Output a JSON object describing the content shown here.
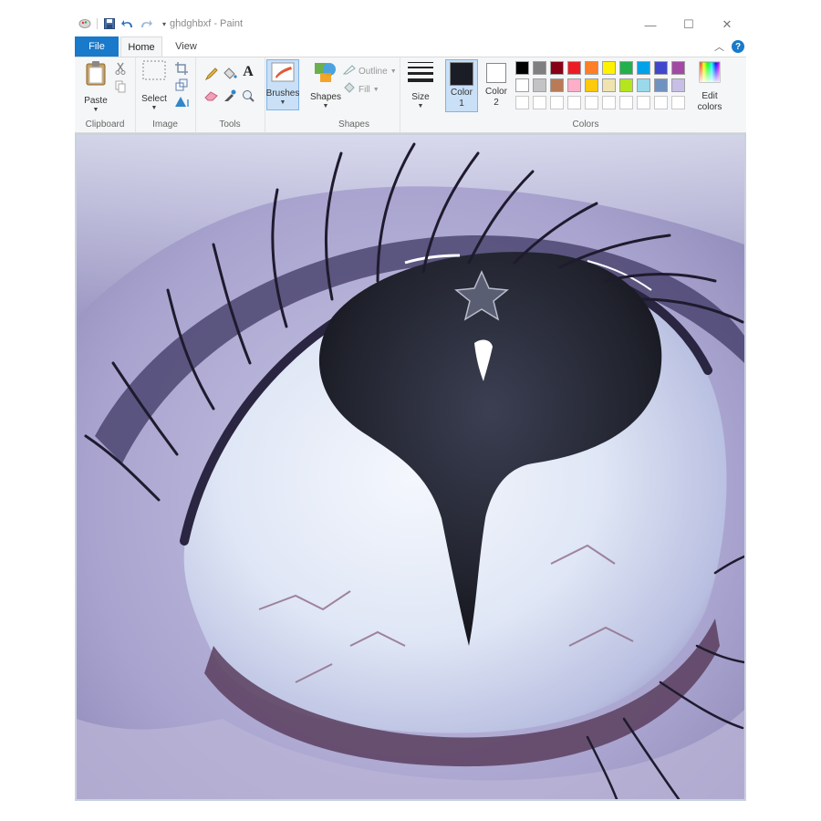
{
  "window": {
    "title": "ghdghbxf - Paint"
  },
  "caption": {
    "minimize": "—",
    "maximize": "☐",
    "close": "✕"
  },
  "tabs": {
    "file": "File",
    "home": "Home",
    "view": "View"
  },
  "help_label": "?",
  "ribbon": {
    "clipboard": {
      "label": "Clipboard",
      "paste_label": "Paste"
    },
    "image": {
      "label": "Image",
      "select_label": "Select"
    },
    "tools": {
      "label": "Tools",
      "text_icon_glyph": "A"
    },
    "brushes": {
      "label": "Brushes"
    },
    "shapes": {
      "label": "Shapes",
      "shapes_label": "Shapes",
      "outline_label": "Outline",
      "fill_label": "Fill"
    },
    "size": {
      "label": "Size"
    },
    "color1": {
      "label": "Color",
      "number": "1",
      "value": "#1b1d26"
    },
    "color2": {
      "label": "Color",
      "number": "2",
      "value": "#ffffff"
    },
    "colors": {
      "label": "Colors",
      "row1": [
        "#000000",
        "#7f7f7f",
        "#880015",
        "#ed1c24",
        "#ff7f27",
        "#fff200",
        "#22b14c",
        "#00a2e8",
        "#3f48cc",
        "#a349a4"
      ],
      "row2": [
        "#ffffff",
        "#c3c3c3",
        "#b97a57",
        "#ffaec9",
        "#ffc90e",
        "#efe4b0",
        "#b5e61d",
        "#99d9ea",
        "#7092be",
        "#c8bfe7"
      ],
      "row3_empty_count": 10
    },
    "edit_colors": {
      "line1": "Edit",
      "line2": "colors"
    }
  },
  "icons": {
    "paint": "paint-app-icon",
    "save": "save-icon",
    "undo": "undo-icon",
    "redo": "redo-icon",
    "paste": "clipboard-icon",
    "cut": "scissors-icon",
    "copy": "copy-icon",
    "select": "selection-rectangle-icon",
    "crop": "crop-icon",
    "resize": "resize-icon",
    "rotate": "rotate-icon",
    "pencil": "pencil-icon",
    "fill": "bucket-fill-icon",
    "text": "text-icon",
    "eraser": "eraser-icon",
    "picker": "color-picker-icon",
    "magnifier": "magnifier-icon",
    "brush": "brush-icon",
    "shapes": "shapes-icon",
    "size": "line-size-icon",
    "edit_colors": "color-wheel-icon"
  }
}
